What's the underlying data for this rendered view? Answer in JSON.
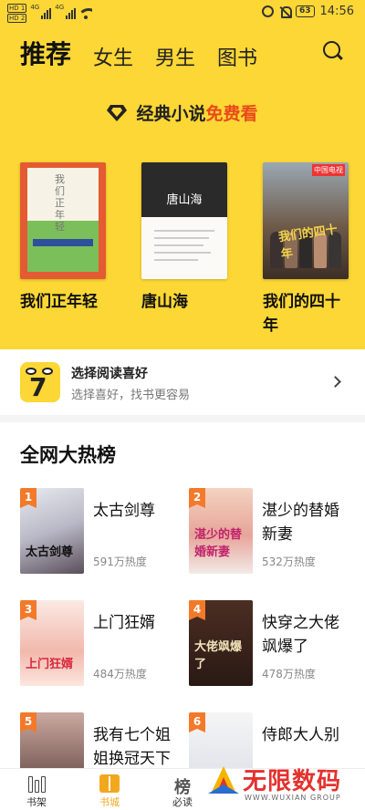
{
  "status_bar": {
    "sim1": "HD 1",
    "sim2": "HD 2",
    "net1": "4G",
    "net2": "4G",
    "battery": "63",
    "time": "14:56"
  },
  "tabs": [
    {
      "label": "推荐",
      "active": true
    },
    {
      "label": "女生",
      "active": false
    },
    {
      "label": "男生",
      "active": false
    },
    {
      "label": "图书",
      "active": false
    }
  ],
  "banner": {
    "prefix": "经典小说",
    "highlight": "免费看"
  },
  "featured_books": [
    {
      "title": "我们正年轻"
    },
    {
      "title": "唐山海"
    },
    {
      "title": "我们的四十年"
    }
  ],
  "preference": {
    "title": "选择阅读喜好",
    "subtitle": "选择喜好，找书更容易"
  },
  "hot_list": {
    "title": "全网大热榜",
    "items": [
      {
        "rank": "1",
        "name": "太古剑尊",
        "heat": "591万热度"
      },
      {
        "rank": "2",
        "name": "湛少的替婚新妻",
        "heat": "532万热度"
      },
      {
        "rank": "3",
        "name": "上门狂婿",
        "heat": "484万热度"
      },
      {
        "rank": "4",
        "name": "快穿之大佬飒爆了",
        "heat": "478万热度"
      },
      {
        "rank": "5",
        "name": "我有七个姐姐换冠天下",
        "heat": ""
      },
      {
        "rank": "6",
        "name": "侍郎大人别",
        "heat": ""
      }
    ]
  },
  "bottom_nav": [
    {
      "label": "书架"
    },
    {
      "label": "书城"
    },
    {
      "label": "必读"
    }
  ],
  "watermark": {
    "text": "无限数码",
    "sub": "WWW.WUXIAN GROUP"
  },
  "colors": {
    "accent": "#fcd735",
    "highlight": "#e84a1b",
    "rank": "#f27a2a"
  }
}
